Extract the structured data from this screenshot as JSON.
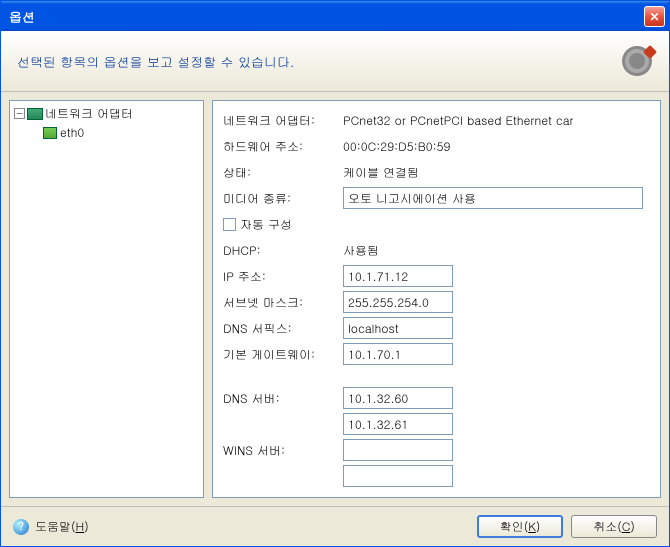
{
  "window": {
    "title": "옵션"
  },
  "header": {
    "text": "선택된 항목의 옵션을 보고 설정할 수 있습니다."
  },
  "tree": {
    "root": "네트워크 어댑터",
    "child": "eth0"
  },
  "details": {
    "adapter_label": "네트워크 어댑터:",
    "adapter_value": "PCnet32 or PCnetPCI based Ethernet car",
    "hwaddr_label": "하드웨어 주소:",
    "hwaddr_value": "00:0C:29:D5:B0:59",
    "status_label": "상태:",
    "status_value": "케이블 연결됨",
    "media_label": "미디어 종류:",
    "media_value": "오토 니고시에이션 사용",
    "autoconf_label": "자동 구성",
    "dhcp_label": "DHCP:",
    "dhcp_value": "사용됨",
    "ip_label": "IP 주소:",
    "ip_value": "10.1.71.12",
    "subnet_label": "서브넷 마스크:",
    "subnet_value": "255.255.254.0",
    "dnssuffix_label": "DNS 서픽스:",
    "dnssuffix_value": "localhost",
    "gateway_label": "기본 게이트웨이:",
    "gateway_value": "10.1.70.1",
    "dnsserver_label": "DNS 서버:",
    "dnsserver_value1": "10.1.32.60",
    "dnsserver_value2": "10.1.32.61",
    "wins_label": "WINS 서버:",
    "wins_value1": "",
    "wins_value2": ""
  },
  "footer": {
    "help": "도움말",
    "help_key": "H",
    "ok": "확인",
    "ok_key": "K",
    "cancel": "취소",
    "cancel_key": "C"
  }
}
